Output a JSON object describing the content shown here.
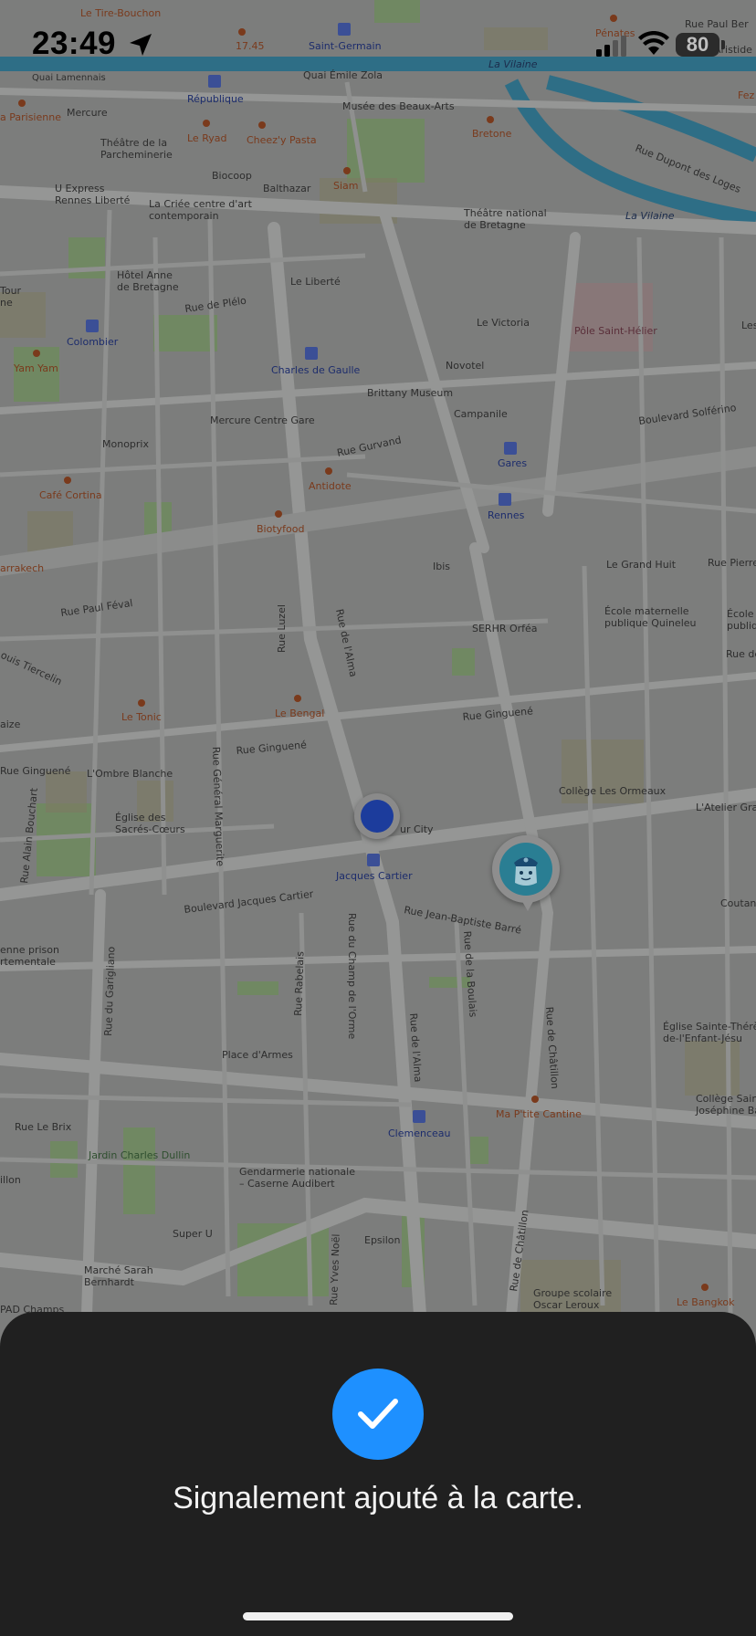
{
  "status_bar": {
    "time": "23:49",
    "battery": "80"
  },
  "map": {
    "labels": {
      "le_tire_bouchon": "Le Tire-Bouchon",
      "pe_17_45": "17.45",
      "saint_germain": "Saint-Germain",
      "penates": "Pénates",
      "rue_paul_bert": "Rue Paul Ber",
      "aristide": "Aristide",
      "fez": "Fez",
      "quai_lamennais": "Quai Lamennais",
      "republique": "République",
      "quai_emile_zola": "Quai Émile Zola",
      "la_vilaine_1": "La Vilaine",
      "musee_beaux_arts": "Musée des Beaux-Arts",
      "parisienne": "a Parisienne",
      "mercure": "Mercure",
      "theatre_parcheminerie": "Théâtre de la\nParcheminerie",
      "le_ryad": "Le Ryad",
      "cheezy_pasta": "Cheez'y Pasta",
      "bretone": "Bretone",
      "rue_dupont_des_loges": "Rue Dupont des Loges",
      "biocoop": "Biocoop",
      "balthazar": "Balthazar",
      "siam": "Siam",
      "u_express": "U Express\nRennes Liberté",
      "la_criee": "La Criée centre d'art\ncontemporain",
      "theatre_national": "Théâtre national\nde Bretagne",
      "la_vilaine_2": "La Vilaine",
      "hotel_anne": "Hôtel Anne\nde Bretagne",
      "le_liberte": "Le Liberté",
      "tour": "Tour\nne",
      "rue_de_plelo": "Rue de Plélo",
      "le_victoria": "Le Victoria",
      "pole_saint_helier": "Pôle Saint-Hélier",
      "les": "Les",
      "colombier": "Colombier",
      "charles_de_gaulle": "Charles de Gaulle",
      "novotel": "Novotel",
      "yam_yam": "Yam Yam",
      "brittany_museum": "Brittany Museum",
      "boulevard_solferino": "Boulevard Solférino",
      "mercure_centre_gare": "Mercure Centre Gare",
      "campanile": "Campanile",
      "monoprix": "Monoprix",
      "rue_gurvand": "Rue Gurvand",
      "gares": "Gares",
      "antidote": "Antidote",
      "cafe_cortina": "Café Cortina",
      "rennes": "Rennes",
      "biotyfood": "Biotyfood",
      "arrakech": "arrakech",
      "ibis": "Ibis",
      "le_grand_huit": "Le Grand Huit",
      "rue_pierre": "Rue Pierre",
      "rue_paul_feval": "Rue Paul Féval",
      "ecole_quineleu": "École maternelle\npublique Quineleu",
      "ecole_right": "École\npublique",
      "rue_luzel": "Rue Luzel",
      "rue_de_l_alma": "Rue de l'Alma",
      "serhr_orfea": "SERHR Orféa",
      "tiercelin": "ouis Tiercelin",
      "rue_de": "Rue de",
      "le_tonic": "Le Tonic",
      "le_bengal": "Le Bengal",
      "rue_ginguene_1": "Rue Ginguené",
      "aize": "aize",
      "rue_ginguene_2": "Rue Ginguené",
      "rue_general_marguerite": "Rue Général Marguerite",
      "rue_ginguene_3": "Rue Ginguené",
      "l_ombre_blanche": "L'Ombre Blanche",
      "college_ormeaux": "Collège Les Ormeaux",
      "l_atelier_gra": "L'Atelier Gra",
      "rue_alain_bouchart": "Rue Alain Bouchart",
      "eglise_sacres_coeurs": "Église des\nSacrés-Cœurs",
      "ur_city": "ur City",
      "jacques_cartier": "Jacques Cartier",
      "boulevard_jacques_cartier": "Boulevard Jacques Cartier",
      "rue_jean_baptiste_barre": "Rue Jean-Baptiste Barré",
      "coutan": "Coutan",
      "ancienne_prison": "enne prison\nrtementale",
      "rue_du_garigliano": "Rue du Garigliano",
      "rue_rabelais": "Rue Rabelais",
      "rue_champ_orme": "Rue du Champ de l'Orme",
      "rue_de_la_boulais": "Rue de la Boulais",
      "rue_de_l_alma_2": "Rue de l'Alma",
      "rue_de_chatillon": "Rue de Châtillon",
      "eglise_sainte_therese": "Église Sainte-Thérè\nde-l'Enfant-Jésu",
      "place_d_armes": "Place d'Armes",
      "college_saint_josephine": "Collège Sain\nJoséphine Bak",
      "rue_le_brix": "Rue Le Brix",
      "clemenceau": "Clemenceau",
      "ma_ptite_cantine": "Ma P'tite Cantine",
      "jardin_charles_dullin": "Jardin Charles Dullin",
      "illon": "illon",
      "gendarmerie": "Gendarmerie nationale\n– Caserne Audibert",
      "super_u": "Super U",
      "epsilon": "Epsilon",
      "rue_de_chatillon_2": "Rue de Châtillon",
      "marche_sarah": "Marché Sarah\nBernhardt",
      "rue_yves_noel": "Rue Yves Noël",
      "groupe_scolaire": "Groupe scolaire\nOscar Leroux",
      "le_bangkok": "Le Bangkok",
      "pad_champs": "PAD Champs"
    }
  },
  "toast": {
    "message": "Signalement ajouté à la carte."
  },
  "colors": {
    "accent": "#1e90ff",
    "sheet_bg": "#202020",
    "map_bg": "#7c7d7c"
  },
  "icons": {
    "check": "checkmark-icon",
    "police": "police-icon",
    "location": "location-arrow-icon"
  }
}
